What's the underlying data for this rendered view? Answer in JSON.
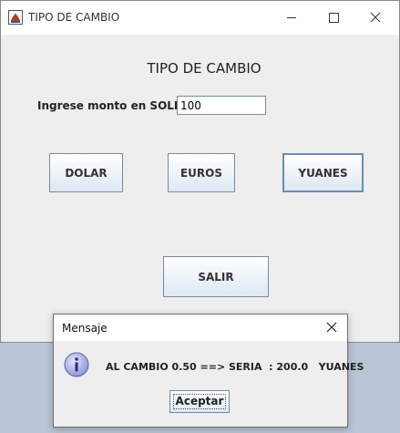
{
  "window": {
    "title": "TIPO DE CAMBIO",
    "icon": "java-app-icon",
    "controls": {
      "minimize": "minimize-icon",
      "maximize": "maximize-icon",
      "close": "close-icon"
    }
  },
  "form": {
    "heading": "TIPO DE CAMBIO",
    "amount_label": "Ingrese monto en SOLES :",
    "amount_value": "100"
  },
  "buttons": {
    "dolar": "DOLAR",
    "euros": "EUROS",
    "yuanes": "YUANES",
    "salir": "SALIR"
  },
  "dialog": {
    "title": "Mensaje",
    "icon": "info-icon",
    "message": "AL CAMBIO 0.50 ==> SERIA  : 200.0   YUANES",
    "ok_label": "Aceptar"
  },
  "colors": {
    "button_border": "#7a8a99",
    "button_focus_border": "#6e8cad",
    "info_icon": "#8a8fd6"
  }
}
